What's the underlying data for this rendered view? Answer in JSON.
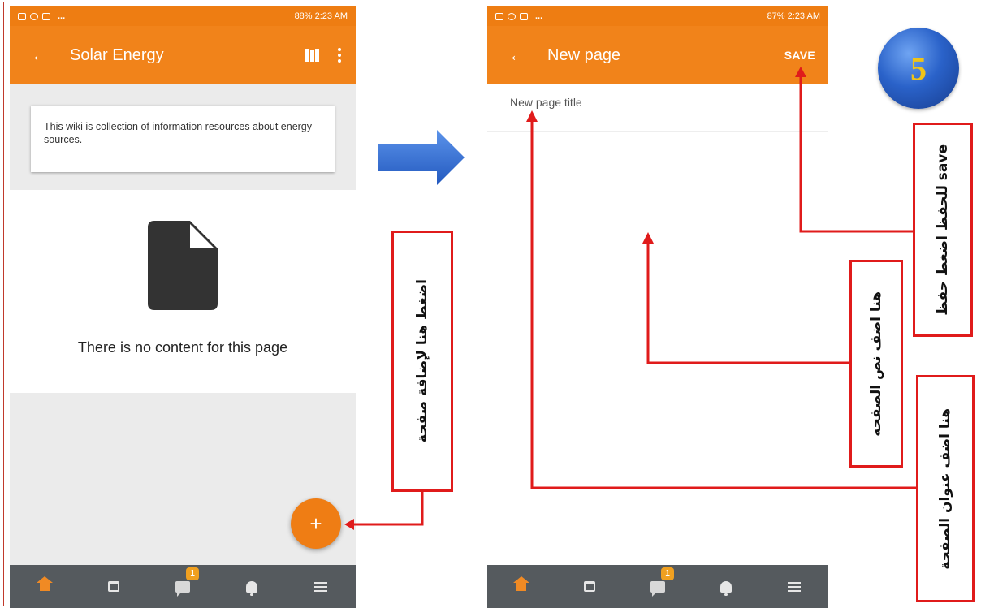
{
  "phone1": {
    "statusbar": {
      "right": "88% 2:23 AM"
    },
    "appbar": {
      "back": "←",
      "title": "Solar Energy"
    },
    "wiki_card": "This wiki is collection of information resources about energy sources.",
    "empty_text": "There is no content for this page",
    "fab": "+",
    "nav": {
      "badge": "1"
    }
  },
  "phone2": {
    "statusbar": {
      "right": "87% 2:23 AM"
    },
    "appbar": {
      "back": "←",
      "title": "New page",
      "save": "SAVE"
    },
    "title_placeholder": "New page title",
    "nav": {
      "badge": "1"
    }
  },
  "annotations": {
    "add_page": "اضغط هنا لإضافة صفحة",
    "save": "للحفظ اضغط حفظ save",
    "page_text": "هنا اضف نص الصفحه",
    "page_title": "هنا اضف عنوان الصفحة",
    "step": "5"
  },
  "colors": {
    "accent": "#f1831a",
    "annotation": "#e01b1b",
    "arrow": "#2f6fd8"
  }
}
